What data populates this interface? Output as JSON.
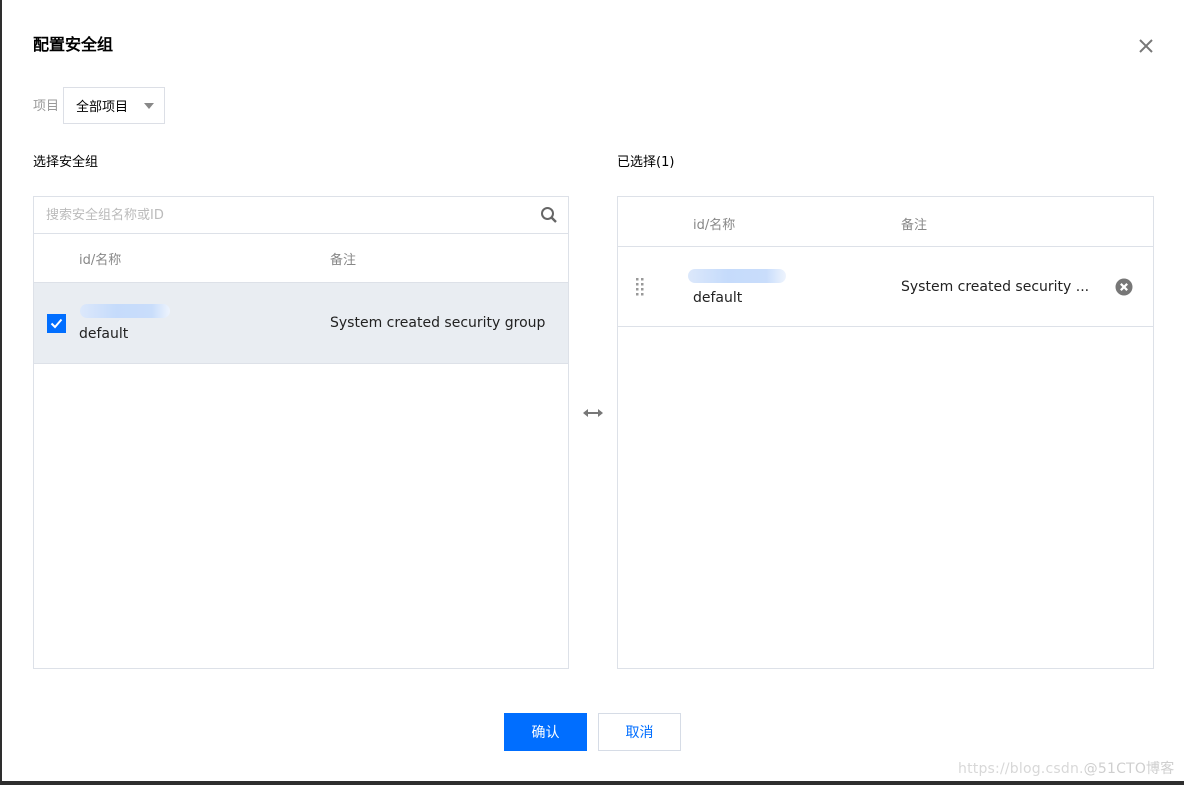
{
  "dialog": {
    "title": "配置安全组",
    "close_icon": "close-icon"
  },
  "project_filter": {
    "label": "项目",
    "selected": "全部项目",
    "icon": "caret-down-icon"
  },
  "left_panel": {
    "title": "选择安全组",
    "search": {
      "placeholder": "搜索安全组名称或ID",
      "value": "",
      "icon": "search-icon"
    },
    "columns": [
      "id/名称",
      "备注"
    ],
    "rows": [
      {
        "checked": true,
        "id": "(redacted)",
        "name": "default",
        "note": "System created security group"
      }
    ]
  },
  "transfer_icon": "swap-horizontal-icon",
  "right_panel": {
    "title": "已选择(1)",
    "columns": [
      "id/名称",
      "备注"
    ],
    "rows": [
      {
        "id": "(redacted)",
        "name": "default",
        "note": "System created security ...",
        "remove_icon": "remove-circle-icon",
        "drag_icon": "drag-handle-icon"
      }
    ]
  },
  "footer": {
    "confirm_label": "确认",
    "cancel_label": "取消"
  },
  "watermark": {
    "url_text": "https://blog.csdn.",
    "brand_text": "@51CTO博客"
  },
  "colors": {
    "primary": "#006eff",
    "border": "#dde1e8",
    "selected_row_bg": "#e9edf2"
  }
}
